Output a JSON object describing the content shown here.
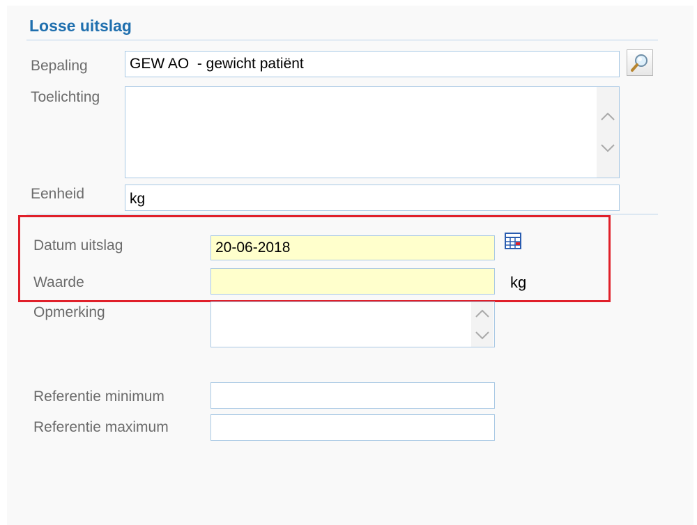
{
  "section": {
    "title": "Losse uitslag"
  },
  "bepaling": {
    "label": "Bepaling",
    "value": "GEW AO  - gewicht patiënt",
    "lookup_icon": "magnifier-icon"
  },
  "toelichting": {
    "label": "Toelichting",
    "value": ""
  },
  "eenheid": {
    "label": "Eenheid",
    "value": "kg"
  },
  "datum_uitslag": {
    "label": "Datum uitslag",
    "value": "20-06-2018",
    "calendar_icon": "calendar-icon"
  },
  "waarde": {
    "label": "Waarde",
    "value": "",
    "unit": "kg"
  },
  "opmerking": {
    "label": "Opmerking",
    "value": ""
  },
  "referentie_minimum": {
    "label": "Referentie minimum",
    "value": ""
  },
  "referentie_maximum": {
    "label": "Referentie maximum",
    "value": ""
  },
  "colors": {
    "title": "#1f6fae",
    "label": "#6b6b6b",
    "field_border": "#a8c8e4",
    "required_field_bg": "#ffffcc",
    "highlight_border": "#e0202a"
  }
}
